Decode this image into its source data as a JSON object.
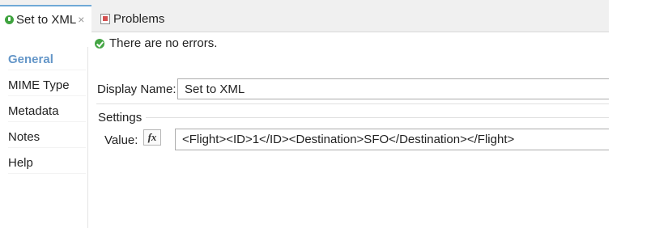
{
  "tabs": [
    {
      "label": "Set to XML",
      "close": "×",
      "active": true
    },
    {
      "label": "Problems",
      "active": false
    }
  ],
  "status": {
    "message": "There are no errors."
  },
  "sidebar": {
    "items": [
      {
        "label": "General",
        "selected": true
      },
      {
        "label": "MIME Type"
      },
      {
        "label": "Metadata"
      },
      {
        "label": "Notes"
      },
      {
        "label": "Help"
      }
    ]
  },
  "form": {
    "display_name_label": "Display Name:",
    "display_name_value": "Set to XML",
    "settings_heading": "Settings",
    "value_label": "Value:",
    "fx_label": "fx",
    "value_text": "<Flight><ID>1</ID><Destination>SFO</Destination></Flight>"
  },
  "colors": {
    "selected_nav": "#6496c8",
    "active_tab_border": "#6fa9d6",
    "ok_green": "#44a544"
  }
}
